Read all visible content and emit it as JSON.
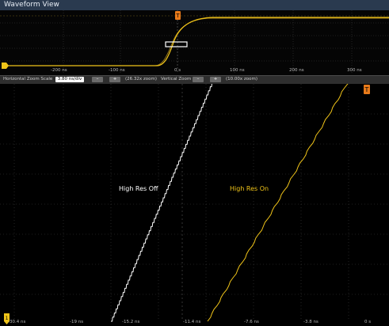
{
  "window": {
    "title": "Waveform View"
  },
  "overview": {
    "time_labels": [
      "-200 ns",
      "-100 ns",
      "0 s",
      "100 ns",
      "200 ns",
      "300 ns"
    ],
    "trigger_marker": "T"
  },
  "zoom_bar": {
    "horizontal_label": "Horizontal Zoom Scale",
    "horizontal_value": "3.80 ns/div",
    "horizontal_zoom": "(26.32x zoom)",
    "vertical_label": "Vertical Zoom",
    "vertical_zoom": "(10.00x zoom)",
    "btn_minus": "–",
    "btn_plus": "+"
  },
  "main": {
    "annotation_off": "High Res Off",
    "annotation_on": "High Res On",
    "time_labels": [
      "-30.4 ns",
      "-19 ns",
      "-15.2 ns",
      "-11.4 ns",
      "-7.6 ns",
      "-3.8 ns",
      "0 s"
    ],
    "trigger_marker": "T",
    "level_marker": "1"
  },
  "colors": {
    "high_res_on": "#f0c419",
    "high_res_off": "#ffffff",
    "title_bar": "#2a3a4f"
  }
}
